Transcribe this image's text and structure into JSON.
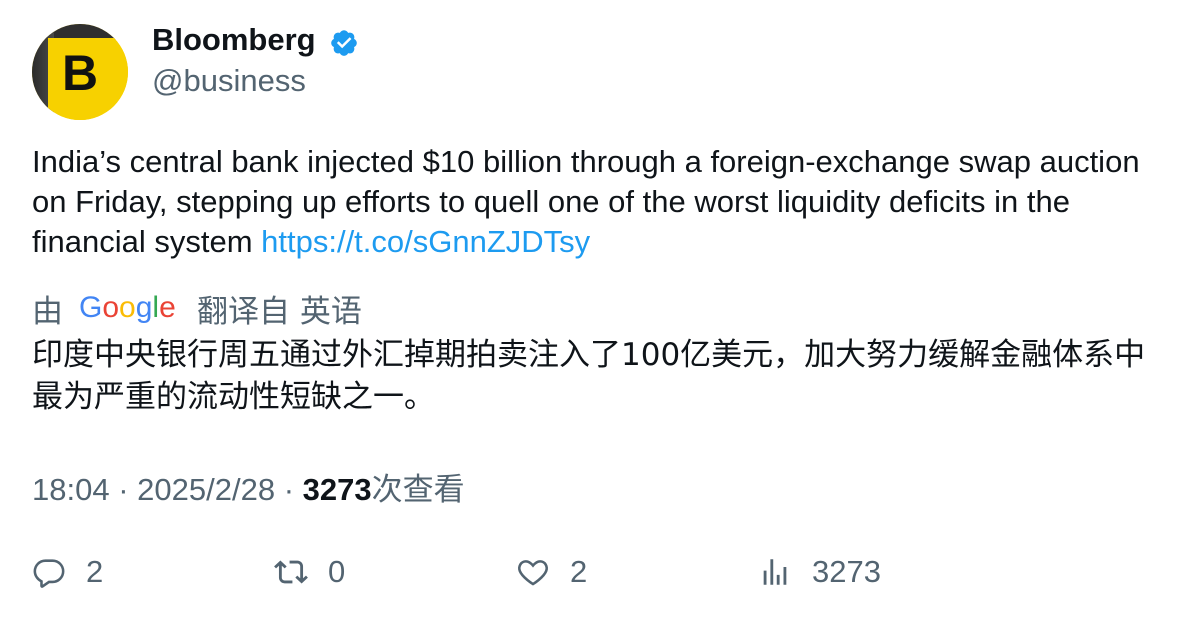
{
  "account": {
    "name": "Bloomberg",
    "handle": "@business",
    "avatar_letter": "B",
    "verified_icon": "verified-badge-icon",
    "colors": {
      "avatar_bg": "#f7d100",
      "verified": "#1d9bf0"
    }
  },
  "tweet": {
    "text": "India’s central bank injected $10 billion through a foreign-exchange swap auction on Friday, stepping up efforts to quell one of the worst liquidity deficits in the financial system ",
    "link": "https://t.co/sGnnZJDTsy"
  },
  "translation": {
    "prefix": "由",
    "provider_logo": "Google",
    "label": "翻译自 英语",
    "text": "印度中央银行周五通过外汇掉期拍卖注入了100亿美元，加大努力缓解金融体系中最为严重的流动性短缺之一。"
  },
  "meta": {
    "time": "18:04",
    "separator": "·",
    "date": "2025/2/28",
    "views": "3273",
    "views_label": "次查看"
  },
  "actions": {
    "reply_count": "2",
    "retweet_count": "0",
    "like_count": "2",
    "views_count": "3273"
  }
}
